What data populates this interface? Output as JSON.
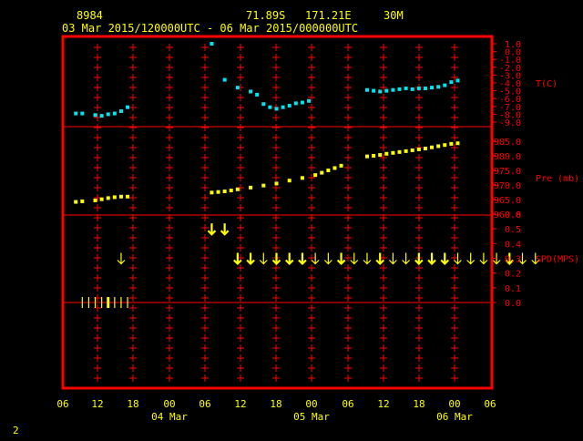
{
  "header": {
    "station_id": "8984",
    "location": "71.89S   171.21E",
    "level": "30M",
    "time_range": "03 Mar 2015/120000UTC - 06 Mar 2015/000000UTC"
  },
  "footer": {
    "page_number": "2"
  },
  "colors": {
    "background": "#000000",
    "frame": "#ff0000",
    "axis_text": "#ffff00",
    "label_text": "#ff0000",
    "temperature": "#00e5ee",
    "pressure": "#ffff00",
    "wind": "#ffff00"
  },
  "chart_data": {
    "type": "scatter",
    "x_axis": {
      "unit": "hours since 03 Mar 2015 06 UTC",
      "range": [
        0,
        66
      ],
      "tick_values": [
        0,
        6,
        12,
        18,
        24,
        30,
        36,
        42,
        48,
        54,
        60,
        66
      ],
      "tick_labels": [
        "06",
        "12",
        "18",
        "00",
        "06",
        "12",
        "18",
        "00",
        "06",
        "12",
        "18",
        "00",
        "06"
      ],
      "date_labels": [
        {
          "text": "04 Mar",
          "at": 24
        },
        {
          "text": "05 Mar",
          "at": 48
        },
        {
          "text": "06 Mar",
          "at": 72
        }
      ]
    },
    "panels": [
      {
        "name": "temperature",
        "label": "T(C)",
        "ylim": [
          -9.0,
          1.0
        ],
        "tick_values": [
          1.0,
          0.0,
          -1.0,
          -2.0,
          -3.0,
          -4.0,
          -5.0,
          -6.0,
          -7.0,
          -8.0,
          -9.0
        ],
        "tick_labels": [
          "1.0",
          "0.0",
          "-1.0",
          "-2.0",
          "-3.0",
          "-4.0",
          "-5.0",
          "-6.0",
          "-7.0",
          "-8.0",
          "-9.0"
        ],
        "series": [
          {
            "name": "T(C)",
            "x": [
              2,
              3,
              5,
              6,
              7,
              8,
              9,
              10,
              23,
              25,
              27,
              29,
              30,
              31,
              32,
              33,
              34,
              35,
              36,
              37,
              38,
              47,
              48,
              49,
              50,
              51,
              52,
              53,
              54,
              55,
              56,
              57,
              58,
              59,
              60,
              61
            ],
            "y": [
              -7.9,
              -7.9,
              -8.1,
              -8.2,
              -8.0,
              -7.9,
              -7.6,
              -7.1,
              1.0,
              -3.6,
              -4.6,
              -5.1,
              -5.5,
              -6.7,
              -7.1,
              -7.3,
              -7.1,
              -6.9,
              -6.6,
              -6.5,
              -6.3,
              -4.9,
              -5.0,
              -5.1,
              -5.0,
              -4.9,
              -4.8,
              -4.7,
              -4.8,
              -4.7,
              -4.7,
              -4.6,
              -4.5,
              -4.3,
              -3.9,
              -3.7
            ]
          }
        ]
      },
      {
        "name": "pressure",
        "label": "Pre (mb)",
        "ylim": [
          960.0,
          985.0
        ],
        "tick_values": [
          985.0,
          980.0,
          975.0,
          970.0,
          965.0,
          960.0
        ],
        "tick_labels": [
          "985.0",
          "980.0",
          "975.0",
          "970.0",
          "965.0",
          "960.0"
        ],
        "series": [
          {
            "name": "Pre (mb)",
            "x": [
              2,
              3,
              5,
              6,
              7,
              8,
              9,
              10,
              23,
              24,
              25,
              26,
              27,
              29,
              31,
              33,
              35,
              37,
              39,
              40,
              41,
              42,
              43,
              47,
              48,
              49,
              50,
              51,
              52,
              53,
              54,
              55,
              56,
              57,
              58,
              59,
              60,
              61
            ],
            "y": [
              964.2,
              964.4,
              964.7,
              965.1,
              965.5,
              965.8,
              966.0,
              966.0,
              967.4,
              967.6,
              967.8,
              968.1,
              968.5,
              969.1,
              969.8,
              970.5,
              971.5,
              972.4,
              973.4,
              974.2,
              975.0,
              975.8,
              976.6,
              979.8,
              980.0,
              980.3,
              980.7,
              981.0,
              981.3,
              981.6,
              981.9,
              982.2,
              982.5,
              982.9,
              983.3,
              983.7,
              984.1,
              984.3
            ]
          }
        ]
      },
      {
        "name": "wind_speed",
        "label": "SPD(MPS)",
        "ylim": [
          0.0,
          0.6
        ],
        "tick_values": [
          0.6,
          0.5,
          0.4,
          0.3,
          0.2,
          0.1,
          0.0
        ],
        "tick_labels": [
          "0.6",
          "0.5",
          "0.4",
          "0.3",
          "0.2",
          "0.1",
          "0.0"
        ],
        "series": [
          {
            "name": "SPD(MPS)",
            "x": [
              9,
              23,
              25,
              27,
              29,
              31,
              33,
              35,
              37,
              39,
              41,
              43,
              45,
              47,
              49,
              51,
              53,
              55,
              57,
              59,
              61,
              63,
              65,
              67,
              69,
              71,
              73
            ],
            "y": [
              0.3,
              0.5,
              0.5,
              0.3,
              0.3,
              0.3,
              0.3,
              0.3,
              0.3,
              0.3,
              0.3,
              0.3,
              0.3,
              0.3,
              0.3,
              0.3,
              0.3,
              0.3,
              0.3,
              0.3,
              0.3,
              0.3,
              0.3,
              0.3,
              0.3,
              0.3,
              0.3
            ],
            "bold": [
              false,
              true,
              true,
              true,
              true,
              false,
              true,
              true,
              true,
              false,
              false,
              true,
              false,
              false,
              true,
              false,
              false,
              true,
              true,
              true,
              false,
              false,
              false,
              false,
              true,
              false,
              false
            ]
          }
        ]
      },
      {
        "name": "wind_direction",
        "label": "",
        "series": [
          {
            "name": "",
            "x": [
              3,
              4,
              5,
              6,
              7,
              8,
              9,
              10
            ],
            "y": [
              0,
              0,
              0,
              0,
              0,
              0,
              0,
              0
            ]
          }
        ]
      }
    ]
  }
}
